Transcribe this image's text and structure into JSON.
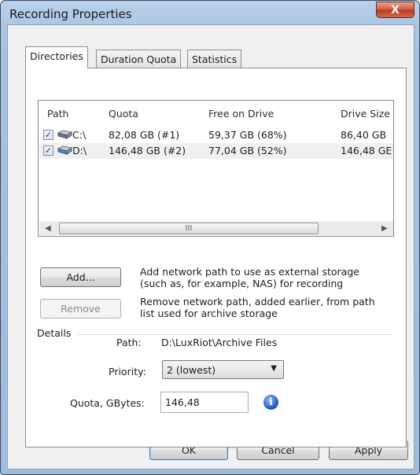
{
  "window": {
    "title": "Recording Properties",
    "close_glyph": "X"
  },
  "tabs": [
    {
      "label": "Directories",
      "active": true
    },
    {
      "label": "Duration Quota",
      "active": false
    },
    {
      "label": "Statistics",
      "active": false
    }
  ],
  "list": {
    "columns": [
      "Path",
      "Quota",
      "Free on Drive",
      "Drive Size"
    ],
    "rows": [
      {
        "checked": true,
        "path": "C:\\",
        "quota": "82,08 GB (#1)",
        "free": "59,37 GB (68%)",
        "size": "86,40 GB",
        "icon": "drive-icon"
      },
      {
        "checked": true,
        "path": "D:\\",
        "quota": "146,48 GB (#2)",
        "free": "77,04 GB (52%)",
        "size": "146,48 GE",
        "icon": "drive-icon"
      }
    ],
    "scroll_grip": "III",
    "check_glyph": "✓",
    "left_arrow": "◀",
    "right_arrow": "▶"
  },
  "actions": {
    "add_label": "Add...",
    "add_desc_1": "Add network path to use as external storage",
    "add_desc_2": "(such as, for example, NAS) for recording",
    "remove_label": "Remove",
    "remove_desc_1": "Remove network path, added earlier, from path",
    "remove_desc_2": "list used for archive storage"
  },
  "details": {
    "group_label": "Details",
    "path_label": "Path:",
    "path_value": "D:\\LuxRiot\\Archive Files",
    "priority_label": "Priority:",
    "priority_value": "2 (lowest)",
    "priority_arrow": "▼",
    "quota_label": "Quota, GBytes:",
    "quota_value": "146,48",
    "info_glyph": "i",
    "info_icon": "info-icon"
  },
  "footer": {
    "ok_label": "OK",
    "cancel_label": "Cancel",
    "apply_label": "Apply"
  }
}
